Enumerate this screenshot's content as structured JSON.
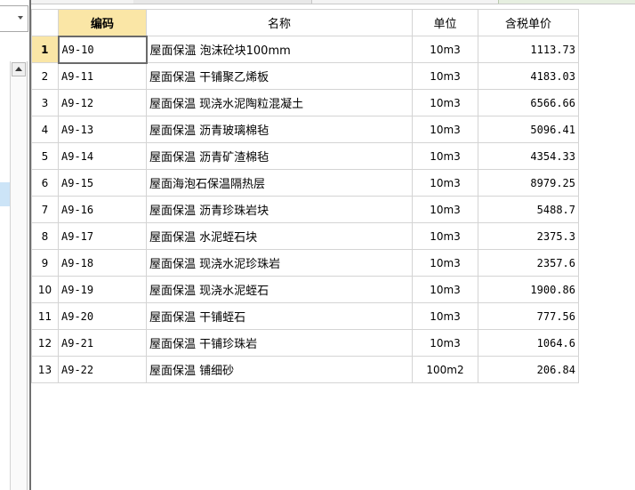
{
  "columns": {
    "code": "编码",
    "name": "名称",
    "unit": "单位",
    "price": "含税单价"
  },
  "rows": [
    {
      "num": "1",
      "code": "A9-10",
      "name": "屋面保温 泡沫砼块100mm",
      "unit": "10m3",
      "price": "1113.73"
    },
    {
      "num": "2",
      "code": "A9-11",
      "name": "屋面保温 干铺聚乙烯板",
      "unit": "10m3",
      "price": "4183.03"
    },
    {
      "num": "3",
      "code": "A9-12",
      "name": "屋面保温 现浇水泥陶粒混凝土",
      "unit": "10m3",
      "price": "6566.66"
    },
    {
      "num": "4",
      "code": "A9-13",
      "name": "屋面保温 沥青玻璃棉毡",
      "unit": "10m3",
      "price": "5096.41"
    },
    {
      "num": "5",
      "code": "A9-14",
      "name": "屋面保温 沥青矿渣棉毡",
      "unit": "10m3",
      "price": "4354.33"
    },
    {
      "num": "6",
      "code": "A9-15",
      "name": "屋面海泡石保温隔热层",
      "unit": "10m3",
      "price": "8979.25"
    },
    {
      "num": "7",
      "code": "A9-16",
      "name": "屋面保温 沥青珍珠岩块",
      "unit": "10m3",
      "price": "5488.7"
    },
    {
      "num": "8",
      "code": "A9-17",
      "name": "屋面保温 水泥蛭石块",
      "unit": "10m3",
      "price": "2375.3"
    },
    {
      "num": "9",
      "code": "A9-18",
      "name": "屋面保温 现浇水泥珍珠岩",
      "unit": "10m3",
      "price": "2357.6"
    },
    {
      "num": "10",
      "code": "A9-19",
      "name": "屋面保温 现浇水泥蛭石",
      "unit": "10m3",
      "price": "1900.86"
    },
    {
      "num": "11",
      "code": "A9-20",
      "name": "屋面保温 干铺蛭石",
      "unit": "10m3",
      "price": "777.56"
    },
    {
      "num": "12",
      "code": "A9-21",
      "name": "屋面保温 干铺珍珠岩",
      "unit": "10m3",
      "price": "1064.6"
    },
    {
      "num": "13",
      "code": "A9-22",
      "name": "屋面保温 铺细砂",
      "unit": "100m2",
      "price": "206.84"
    }
  ],
  "icons": {
    "combo": "chevron-down-icon",
    "scroll_up": "scroll-up-arrow-icon"
  },
  "colors": {
    "header_active": "#fae6a6",
    "tree_selection": "#cce4f7",
    "gridline": "#d4d4d4"
  }
}
